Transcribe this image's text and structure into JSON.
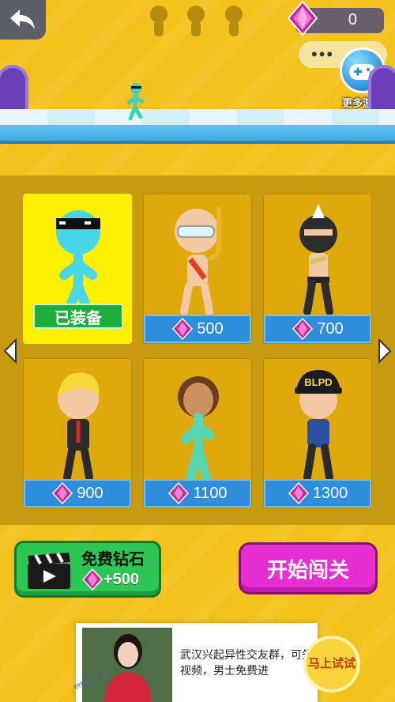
{
  "hud": {
    "gem_count": "0",
    "menu_dots": "•••",
    "more_games_label": "更多游戏"
  },
  "shop": {
    "items": [
      {
        "name": "sunglasses-stickman",
        "status": "已装备",
        "selected": true
      },
      {
        "name": "snorkel-character",
        "price": "500"
      },
      {
        "name": "masked-character",
        "price": "700"
      },
      {
        "name": "blond-suit-character",
        "price": "900"
      },
      {
        "name": "green-stickman",
        "price": "1100"
      },
      {
        "name": "police-character",
        "price": "1300"
      }
    ]
  },
  "free_diamonds": {
    "title": "免费钻石",
    "amount": "+500"
  },
  "start_button": "开始闯关",
  "ad": {
    "text": "武汉兴起异性交友群，可先视频，男士免费进",
    "cta": "马上试试",
    "tag": "ertise 广告"
  },
  "colors": {
    "background": "#f3c21d",
    "panel": "#c79a10",
    "gem": "#d63aa8",
    "price_bar": "#2f8edb",
    "equipped": "#1fad3c",
    "start": "#e62fd1"
  }
}
